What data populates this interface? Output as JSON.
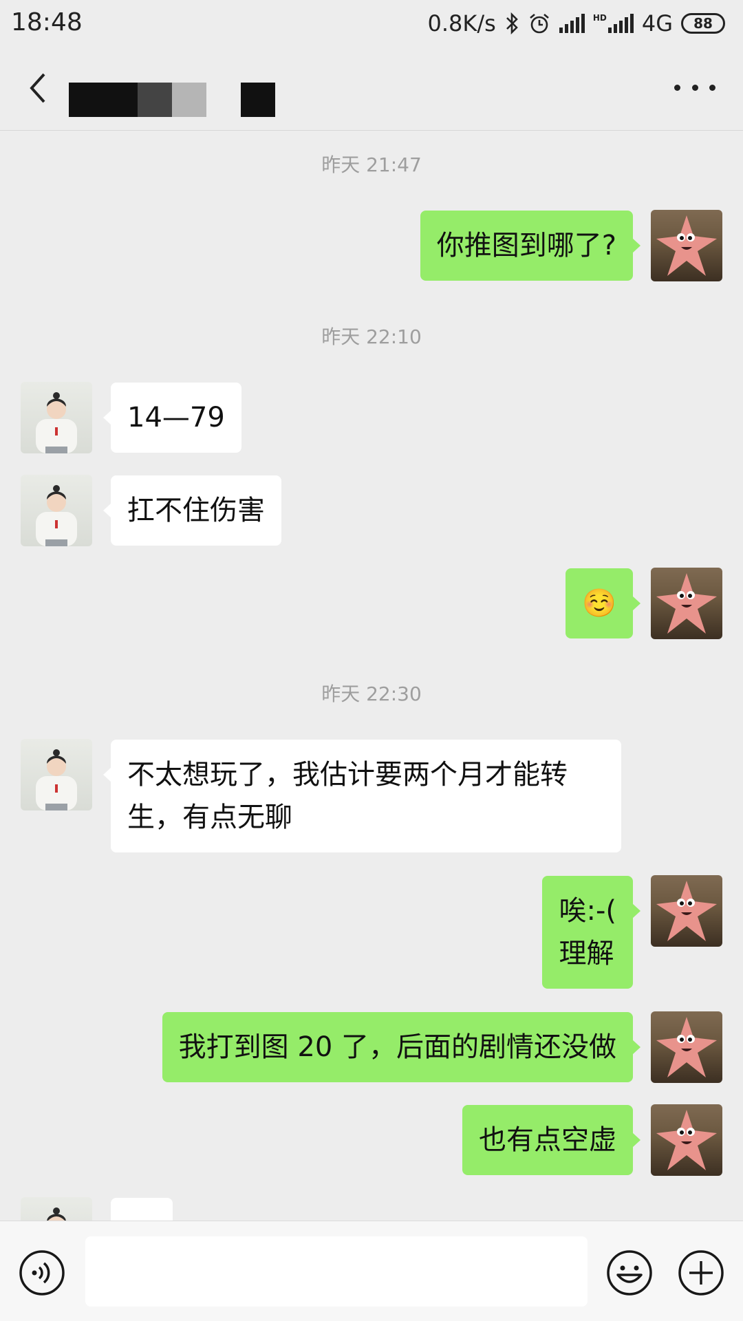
{
  "status_bar": {
    "time": "18:48",
    "net_speed": "0.8K/s",
    "hd": "HD",
    "network": "4G",
    "battery": "88"
  },
  "header": {
    "back_icon": "chevron-left-icon",
    "more_icon": "more-dots-icon"
  },
  "messages": [
    {
      "kind": "time",
      "text": "昨天 21:47"
    },
    {
      "kind": "msg",
      "from": "me",
      "text": "你推图到哪了?"
    },
    {
      "kind": "time",
      "text": "昨天 22:10"
    },
    {
      "kind": "msg",
      "from": "them",
      "text": "14—79"
    },
    {
      "kind": "msg",
      "from": "them",
      "text": "扛不住伤害"
    },
    {
      "kind": "msg",
      "from": "me",
      "text": "☺️"
    },
    {
      "kind": "time",
      "text": "昨天 22:30"
    },
    {
      "kind": "msg",
      "from": "them",
      "text": "不太想玩了，我估计要两个月才能转生，有点无聊"
    },
    {
      "kind": "msg",
      "from": "me",
      "text": "唉:-(\n理解"
    },
    {
      "kind": "msg",
      "from": "me",
      "text": "我打到图 20 了，后面的剧情还没做"
    },
    {
      "kind": "msg",
      "from": "me",
      "text": "也有点空虚"
    }
  ],
  "input_bar": {
    "voice_icon": "voice-icon",
    "emoji_icon": "emoji-icon",
    "plus_icon": "plus-icon",
    "placeholder": ""
  },
  "colors": {
    "background": "#ededed",
    "bubble_me": "#95ec69",
    "bubble_them": "#ffffff",
    "timestamp": "#9e9e9e"
  }
}
